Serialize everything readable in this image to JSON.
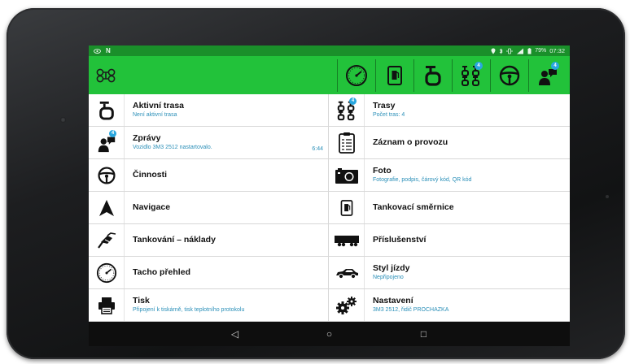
{
  "statusbar": {
    "left_icons": [
      "eye-icon",
      "notification-n-icon"
    ],
    "battery": "79%",
    "time": "07:32"
  },
  "appbar": {
    "logo_icon": "vehicle-axle-logo-icon",
    "actions": [
      {
        "name": "tacho-action",
        "icon": "speedometer-icon"
      },
      {
        "name": "fuel-guide-action",
        "icon": "fuel-card-icon"
      },
      {
        "name": "active-route-action",
        "icon": "route-icon"
      },
      {
        "name": "routes-action",
        "icon": "routes-grid-icon",
        "badge": "4"
      },
      {
        "name": "activities-action",
        "icon": "steering-wheel-icon"
      },
      {
        "name": "messages-action",
        "icon": "messages-driver-icon",
        "badge": "4"
      }
    ]
  },
  "menu": {
    "left": [
      {
        "id": "active-route",
        "title": "Aktivní trasa",
        "sub": "Není aktivní trasa",
        "icon": "route-icon"
      },
      {
        "id": "messages",
        "title": "Zprávy",
        "sub": "Vozidlo 3M3 2512 nastartovalo.",
        "time": "6:44",
        "icon": "messages-driver-icon",
        "badge": "4"
      },
      {
        "id": "activities",
        "title": "Činnosti",
        "sub": "",
        "icon": "steering-wheel-icon"
      },
      {
        "id": "navigation",
        "title": "Navigace",
        "sub": "",
        "icon": "navigation-arrow-icon"
      },
      {
        "id": "fueling",
        "title": "Tankování – náklady",
        "sub": "",
        "icon": "fuel-nozzle-icon"
      },
      {
        "id": "tacho",
        "title": "Tacho přehled",
        "sub": "",
        "icon": "speedometer-icon"
      },
      {
        "id": "print",
        "title": "Tisk",
        "sub": "Připojení k tiskárně, tisk teplotního protokolu",
        "icon": "printer-icon"
      }
    ],
    "right": [
      {
        "id": "routes",
        "title": "Trasy",
        "sub": "Počet tras: 4",
        "icon": "routes-grid-icon",
        "badge": "4"
      },
      {
        "id": "operation-log",
        "title": "Záznam o provozu",
        "sub": "",
        "icon": "clipboard-icon"
      },
      {
        "id": "photo",
        "title": "Foto",
        "sub": "Fotografie, podpis, čárový kód, QR kód",
        "icon": "camera-icon"
      },
      {
        "id": "fuel-guide",
        "title": "Tankovací směrnice",
        "sub": "",
        "icon": "fuel-card-icon"
      },
      {
        "id": "accessories",
        "title": "Příslušenství",
        "sub": "",
        "icon": "trailer-truck-icon"
      },
      {
        "id": "driving-style",
        "title": "Styl jízdy",
        "sub": "Nepřipojeno",
        "icon": "car-icon"
      },
      {
        "id": "settings",
        "title": "Nastavení",
        "sub": "3M3 2512, řidič PROCHAZKA",
        "icon": "gears-icon"
      }
    ]
  },
  "navbar": {
    "back": "◁",
    "home": "○",
    "recents": "□"
  },
  "colors": {
    "appbar": "#22c23a",
    "statusbar": "#1a8f2a",
    "badge": "#29a7df",
    "subtext": "#2a8fb8"
  }
}
